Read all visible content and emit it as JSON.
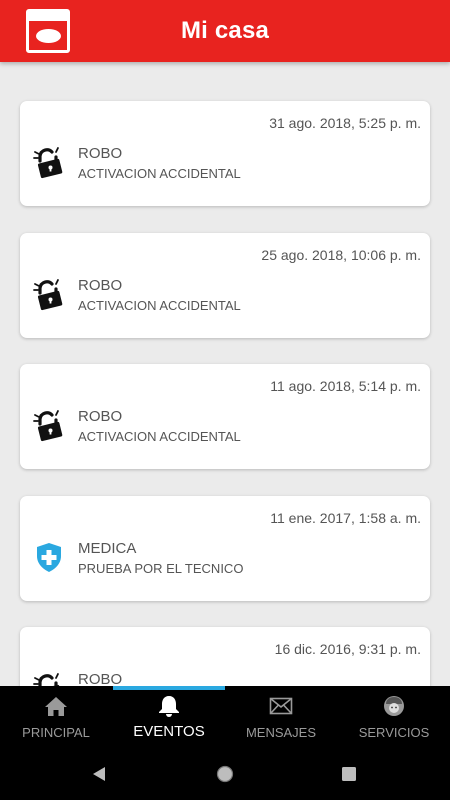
{
  "header": {
    "title": "Mi casa",
    "logo_icon": "company-logo-icon",
    "color": "#e8231f"
  },
  "events": [
    {
      "timestamp": "31 ago. 2018, 5:25 p. m.",
      "type": "ROBO",
      "description": "ACTIVACION ACCIDENTAL",
      "icon": "broken-lock-icon"
    },
    {
      "timestamp": "25 ago. 2018, 10:06 p. m.",
      "type": "ROBO",
      "description": "ACTIVACION ACCIDENTAL",
      "icon": "broken-lock-icon"
    },
    {
      "timestamp": "11 ago. 2018, 5:14 p. m.",
      "type": "ROBO",
      "description": "ACTIVACION ACCIDENTAL",
      "icon": "broken-lock-icon"
    },
    {
      "timestamp": "11 ene. 2017, 1:58 a. m.",
      "type": "MEDICA",
      "description": "PRUEBA POR EL TECNICO",
      "icon": "medical-shield-icon",
      "icon_color": "#2aa8e0"
    },
    {
      "timestamp": "16 dic. 2016, 9:31 p. m.",
      "type": "ROBO",
      "description": "",
      "icon": "broken-lock-icon"
    }
  ],
  "bottom_nav": {
    "active_color": "#2aa8e0",
    "items": [
      {
        "label": "PRINCIPAL",
        "icon": "home-icon",
        "active": false
      },
      {
        "label": "EVENTOS",
        "icon": "bell-icon",
        "active": true
      },
      {
        "label": "MENSAJES",
        "icon": "envelope-icon",
        "active": false
      },
      {
        "label": "SERVICIOS",
        "icon": "technician-icon",
        "active": false
      }
    ]
  },
  "system_nav": {
    "back_icon": "back-triangle-icon",
    "home_icon": "home-circle-icon",
    "recent_icon": "recent-apps-icon"
  }
}
